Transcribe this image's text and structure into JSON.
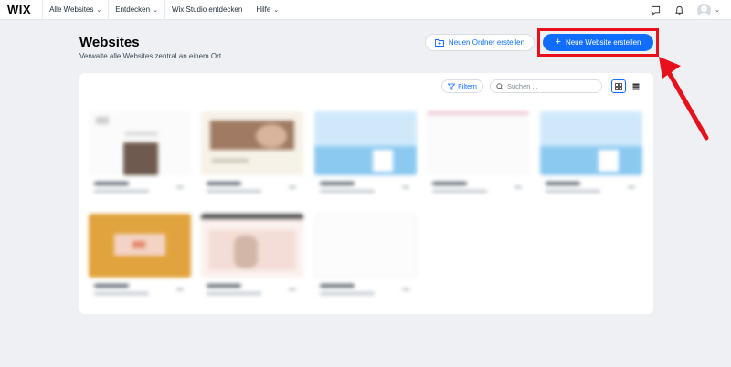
{
  "topbar": {
    "logo": "WIX",
    "nav": [
      {
        "label": "Alle Websites",
        "chevron": true
      },
      {
        "label": "Entdecken",
        "chevron": true
      },
      {
        "label": "Wix Studio entdecken",
        "chevron": false
      },
      {
        "label": "Hilfe",
        "chevron": true
      }
    ],
    "icons": [
      "chat-icon",
      "bell-icon",
      "avatar"
    ]
  },
  "header": {
    "title": "Websites",
    "subtitle": "Verwalte alle Websites zentral an einem Ort.",
    "folder_button": "Neuen Ordner erstellen",
    "new_button": "Neue Website erstellen"
  },
  "toolbar": {
    "filter_label": "Filtern",
    "search_placeholder": "Suchen ..."
  },
  "colors": {
    "accent": "#116dff",
    "highlight": "#e8101b"
  }
}
